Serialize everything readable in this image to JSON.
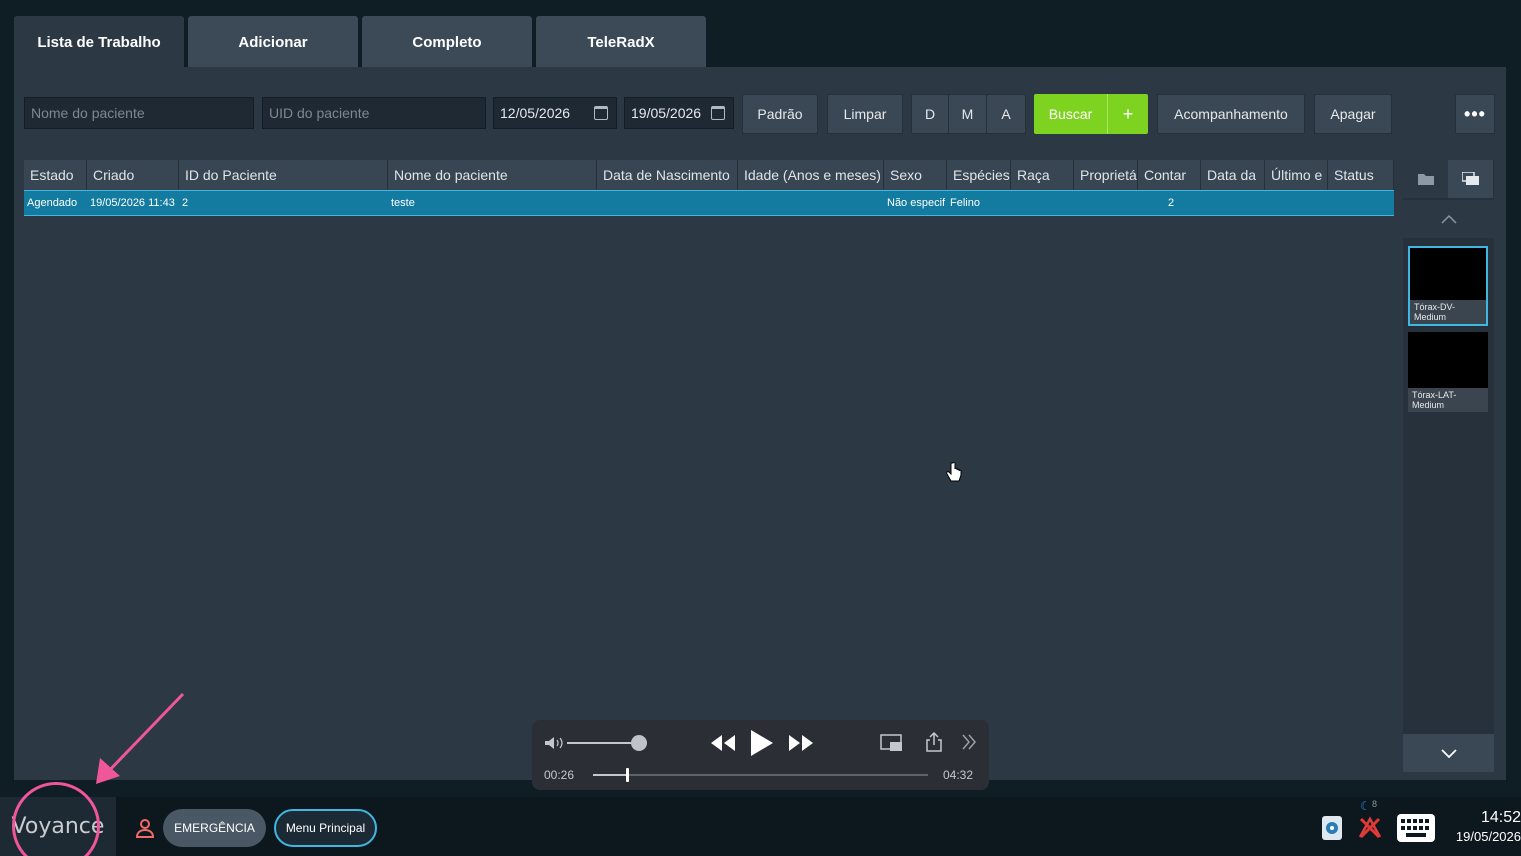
{
  "tabs": [
    "Lista de Trabalho",
    "Adicionar",
    "Completo",
    "TeleRadX"
  ],
  "filters": {
    "patient_name_placeholder": "Nome do paciente",
    "patient_uid_placeholder": "UID do paciente",
    "date_from": "12/05/2026",
    "date_to": "19/05/2026",
    "default_label": "Padrão",
    "clear_label": "Limpar",
    "d_label": "D",
    "m_label": "M",
    "a_label": "A",
    "search_label": "Buscar",
    "search_add": "+",
    "follow_up_label": "Acompanhamento",
    "delete_label": "Apagar",
    "more_label": "•••"
  },
  "table": {
    "columns": [
      "Estado",
      "Criado",
      "ID do Paciente",
      "Nome do paciente",
      "Data de Nascimento",
      "Idade (Anos e meses)",
      "Sexo",
      "Espécies",
      "Raça",
      "Proprietário",
      "Contar",
      "Data da",
      "Último e",
      "Status"
    ],
    "rows": [
      [
        "Agendado",
        "19/05/2026 11:43",
        "2",
        "teste",
        "",
        "",
        "Não especif",
        "Felino",
        "",
        "",
        "2",
        "",
        "",
        ""
      ]
    ]
  },
  "thumbnails": [
    {
      "label": "Tórax-DV-Medium",
      "selected": true
    },
    {
      "label": "Tórax-LAT-Medium",
      "selected": false
    }
  ],
  "media": {
    "elapsed": "00:26",
    "duration": "04:32",
    "volume_level": 0.9,
    "progress": 0.1
  },
  "taskbar": {
    "logo": "Voyance",
    "emergency_label": "EMERGÊNCIA",
    "main_menu_label": "Menu Principal",
    "tray_badge": "8",
    "time": "14:52",
    "date": "19/05/2026"
  },
  "colors": {
    "accent_green": "#7ed321",
    "row_selected": "#137ba0",
    "annotation_pink": "#f0569a"
  }
}
